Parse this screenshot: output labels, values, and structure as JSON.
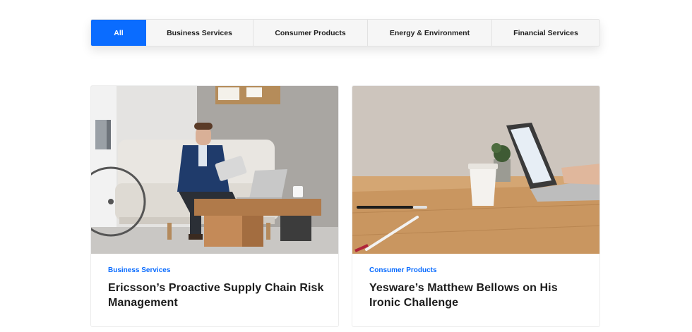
{
  "filters": {
    "tabs": [
      {
        "label": "All",
        "active": true
      },
      {
        "label": "Business Services",
        "active": false
      },
      {
        "label": "Consumer Products",
        "active": false
      },
      {
        "label": "Energy & Environment",
        "active": false
      },
      {
        "label": "Financial Services",
        "active": false
      }
    ],
    "accent_color": "#0a6cff"
  },
  "cards": [
    {
      "category": "Business Services",
      "title": "Ericsson’s Proactive Supply Chain Risk Management",
      "image": "man-on-sofa-with-tablet-photo"
    },
    {
      "category": "Consumer Products",
      "title": "Yesware’s Matthew Bellows on His Ironic Challenge",
      "image": "laptop-on-wooden-desk-photo"
    }
  ]
}
